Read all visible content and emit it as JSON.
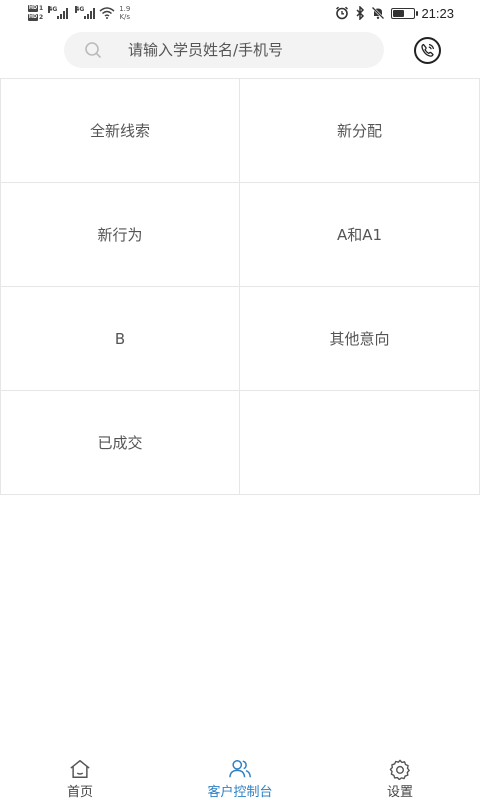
{
  "status_bar": {
    "sim1": "1",
    "sim2": "2",
    "hd": "HD",
    "network": "4G",
    "speed_value": "1.9",
    "speed_unit": "K/s",
    "battery_level": 0.55,
    "time": "21:23"
  },
  "search": {
    "placeholder": "请输入学员姓名/手机号",
    "value": ""
  },
  "grid": {
    "items": [
      {
        "label": "全新线索"
      },
      {
        "label": "新分配"
      },
      {
        "label": "新行为"
      },
      {
        "label": "A和A1"
      },
      {
        "label": "B"
      },
      {
        "label": "其他意向"
      },
      {
        "label": "已成交"
      },
      {
        "label": ""
      }
    ]
  },
  "nav": {
    "items": [
      {
        "label": "首页",
        "icon": "home-icon"
      },
      {
        "label": "客户控制台",
        "icon": "users-icon",
        "active": true
      },
      {
        "label": "设置",
        "icon": "gear-icon"
      }
    ]
  },
  "colors": {
    "accent": "#2f80c3",
    "divider": "#e6e6e6",
    "search_bg": "#f3f3f3"
  }
}
